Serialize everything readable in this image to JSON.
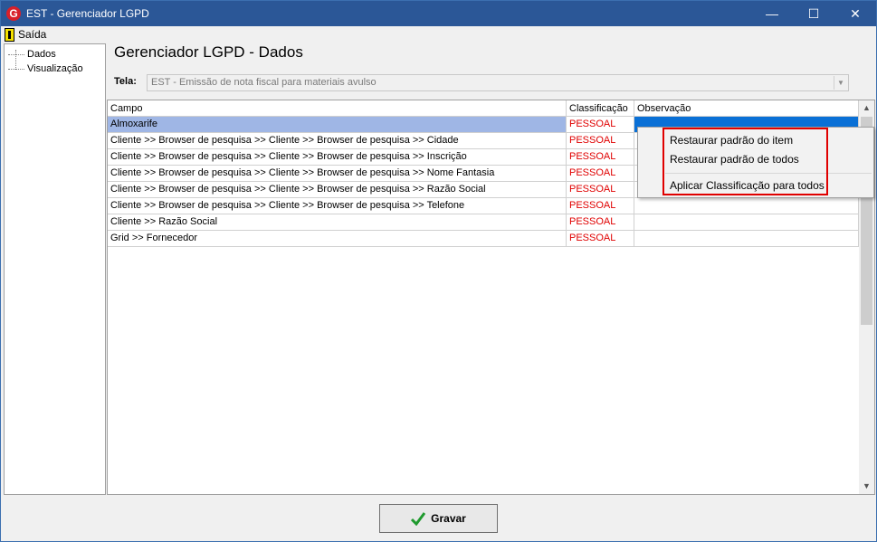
{
  "window": {
    "title": "EST - Gerenciador LGPD",
    "logo_letter": "G",
    "minimize": "—",
    "maximize": "☐",
    "close": "✕"
  },
  "menu": {
    "exit_label": "Saída"
  },
  "tree": {
    "items": [
      "Dados",
      "Visualização"
    ]
  },
  "page": {
    "heading": "Gerenciador LGPD - Dados",
    "screen_label": "Tela:",
    "screen_value": "EST - Emissão de nota fiscal para materiais avulso"
  },
  "grid": {
    "columns": [
      "Campo",
      "Classificação",
      "Observação"
    ],
    "rows": [
      {
        "campo": "Almoxarife",
        "classificacao": "PESSOAL",
        "observacao": ""
      },
      {
        "campo": "Cliente >> Browser de pesquisa >> Cliente >> Browser de pesquisa >> Cidade",
        "classificacao": "PESSOAL",
        "observacao": ""
      },
      {
        "campo": "Cliente >> Browser de pesquisa >> Cliente >> Browser de pesquisa >> Inscrição",
        "classificacao": "PESSOAL",
        "observacao": ""
      },
      {
        "campo": "Cliente >> Browser de pesquisa >> Cliente >> Browser de pesquisa >> Nome Fantasia",
        "classificacao": "PESSOAL",
        "observacao": ""
      },
      {
        "campo": "Cliente >> Browser de pesquisa >> Cliente >> Browser de pesquisa >> Razão Social",
        "classificacao": "PESSOAL",
        "observacao": ""
      },
      {
        "campo": "Cliente >> Browser de pesquisa >> Cliente >> Browser de pesquisa >> Telefone",
        "classificacao": "PESSOAL",
        "observacao": ""
      },
      {
        "campo": "Cliente >> Razão Social",
        "classificacao": "PESSOAL",
        "observacao": ""
      },
      {
        "campo": "Grid >> Fornecedor",
        "classificacao": "PESSOAL",
        "observacao": ""
      }
    ]
  },
  "context_menu": {
    "items": [
      "Restaurar padrão do item",
      "Restaurar padrão de todos",
      "Aplicar Classificação para todos"
    ]
  },
  "footer": {
    "save_label": "Gravar"
  },
  "colors": {
    "titlebar": "#2b5797",
    "selected_row": "#9fb6e5",
    "selected_cell": "#0a70d6",
    "classification": "#e00000",
    "highlight": "#e00000"
  }
}
